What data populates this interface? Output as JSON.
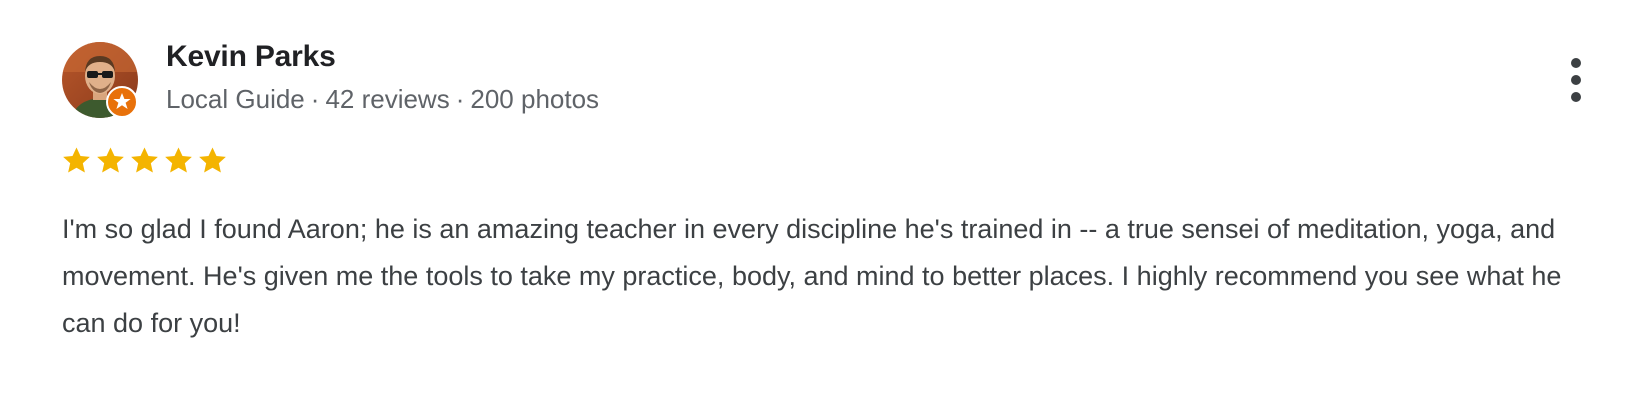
{
  "review": {
    "author": {
      "name": "Kevin Parks",
      "badge": "Local Guide",
      "reviews_count": "42 reviews",
      "photos_count": "200 photos",
      "separator": "·",
      "avatar_icon": "user-avatar-photo",
      "badge_icon": "local-guide-star-badge"
    },
    "rating": {
      "value": 5,
      "max": 5,
      "star_color": "#F4B400"
    },
    "text": "I'm so glad I found Aaron; he is an amazing teacher in every discipline he's trained in -- a true sensei of meditation, yoga, and movement. He's given me the tools to take my practice, body, and mind to better places. I highly recommend you see what he can do for you!",
    "menu_icon": "more-vert-icon"
  },
  "colors": {
    "name": "#202124",
    "meta": "#5f6368",
    "body": "#3c4043",
    "badge_orange": "#E8710A"
  }
}
